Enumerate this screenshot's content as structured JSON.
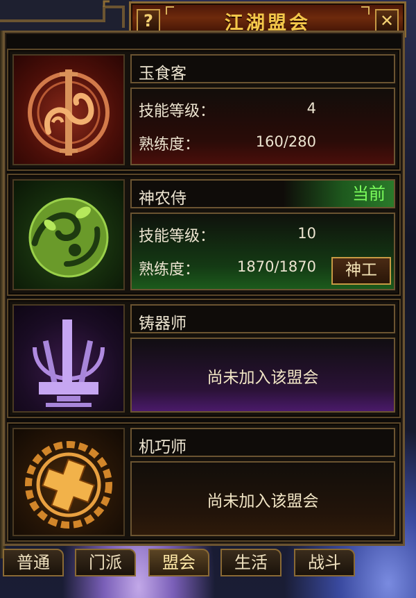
{
  "window": {
    "title": "江湖盟会",
    "help_label": "?",
    "close_label": "✕"
  },
  "guilds": [
    {
      "name": "玉食客",
      "icon": "chef-emblem-icon",
      "skill_level_label": "技能等级：",
      "skill_level": "4",
      "proficiency_label": "熟练度：",
      "proficiency": "160/280"
    },
    {
      "name": "神农侍",
      "icon": "herbalist-emblem-icon",
      "current_label": "当前",
      "skill_level_label": "技能等级：",
      "skill_level": "10",
      "proficiency_label": "熟练度：",
      "proficiency": "1870/1870",
      "action_label": "神工"
    },
    {
      "name": "铸器师",
      "icon": "forge-emblem-icon",
      "status": "尚未加入该盟会"
    },
    {
      "name": "机巧师",
      "icon": "mechanist-emblem-icon",
      "status": "尚未加入该盟会"
    }
  ],
  "tabs": [
    {
      "label": "普通"
    },
    {
      "label": "门派"
    },
    {
      "label": "盟会",
      "active": true
    },
    {
      "label": "生活"
    },
    {
      "label": "战斗"
    }
  ],
  "colors": {
    "title_gold": "#f3c74a",
    "current_green": "#7cff5c",
    "card1_tint": "#6a1410",
    "card2_tint": "#1c5a1c",
    "card3_tint": "#4a1a6a",
    "card4_tint": "#5a2c08"
  }
}
